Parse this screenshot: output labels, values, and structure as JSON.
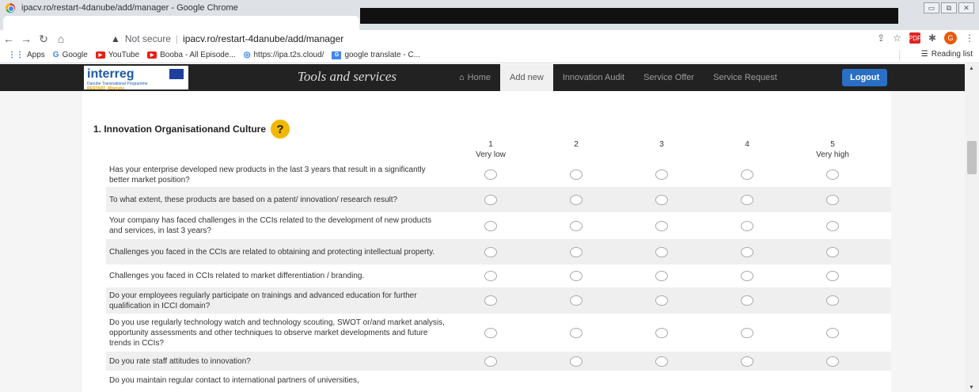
{
  "browser": {
    "window_title": "ipacv.ro/restart-4danube/add/manager - Google Chrome",
    "security_label": "Not secure",
    "url": "ipacv.ro/restart-4danube/add/manager",
    "avatar_letter": "G",
    "pdf_label": "PDF"
  },
  "bookmarks": {
    "items": [
      {
        "icon": "apps-icon",
        "label": "Apps"
      },
      {
        "icon": "google-icon",
        "label": "Google"
      },
      {
        "icon": "youtube-icon",
        "label": "YouTube"
      },
      {
        "icon": "youtube-icon",
        "label": "Booba - All Episode..."
      },
      {
        "icon": "globe-icon",
        "label": "https://ipa.t2s.cloud/"
      },
      {
        "icon": "translate-icon",
        "label": "google translate - C..."
      }
    ],
    "reading_list": "Reading list"
  },
  "site": {
    "logo_word": "interreg",
    "logo_sub1": "Danube Transnational Programme",
    "logo_sub2": "RESTART_4Danube",
    "brand": "Tools and services",
    "nav": {
      "home": "Home",
      "add_new": "Add new",
      "innovation_audit": "Innovation Audit",
      "service_offer": "Service Offer",
      "service_request": "Service Request",
      "logout": "Logout"
    }
  },
  "questionnaire": {
    "section_title": "1. Innovation Organisationand Culture",
    "help_symbol": "?",
    "scale": [
      {
        "num": "1",
        "label": "Very low"
      },
      {
        "num": "2",
        "label": ""
      },
      {
        "num": "3",
        "label": ""
      },
      {
        "num": "4",
        "label": ""
      },
      {
        "num": "5",
        "label": "Very high"
      }
    ],
    "questions": [
      "Has your enterprise developed new products in the last 3 years that result in a significantly better market position?",
      "To what extent, these products are based on a patent/ innovation/ research result?",
      "Your company has faced challenges in the CCIs related to the development of new products and services, in last 3 years?",
      "Challenges you faced in the CCIs are related to obtaining and protecting intellectual property.",
      "Challenges you faced in CCIs related to market differentiation / branding.",
      "Do your employees regularly participate on trainings and advanced education for further qualification in ICCI domain?",
      "Do you use regularly technology watch and technology scouting, SWOT or/and market analysis, opportunity assessments and other techniques to observe market developments and future trends in CCIs?",
      "Do you rate staff attitudes to innovation?",
      "Do you maintain regular contact to international partners of universities,"
    ]
  }
}
